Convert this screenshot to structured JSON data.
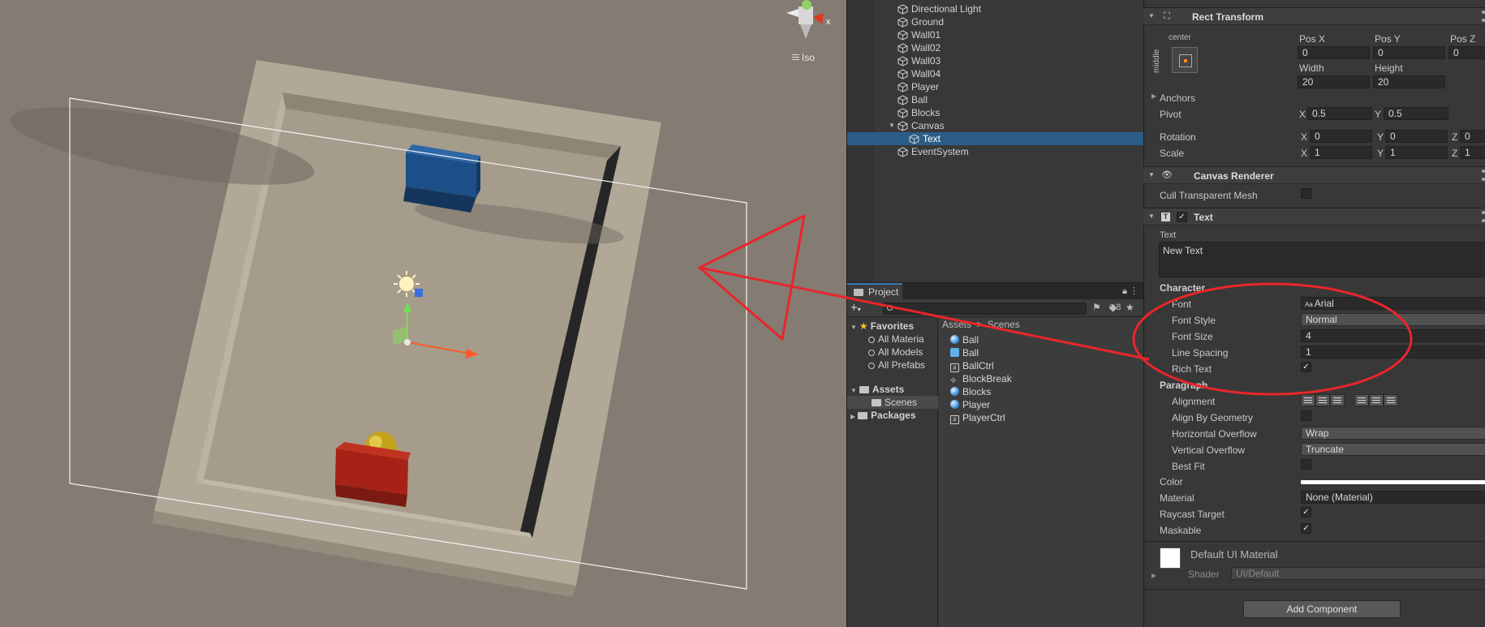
{
  "scene": {
    "view_mode": "Iso",
    "gizmo_axis": "x"
  },
  "hierarchy": {
    "items": [
      {
        "label": "Directional Light",
        "depth": 0
      },
      {
        "label": "Ground",
        "depth": 0
      },
      {
        "label": "Wall01",
        "depth": 0
      },
      {
        "label": "Wall02",
        "depth": 0
      },
      {
        "label": "Wall03",
        "depth": 0
      },
      {
        "label": "Wall04",
        "depth": 0
      },
      {
        "label": "Player",
        "depth": 0
      },
      {
        "label": "Ball",
        "depth": 0
      },
      {
        "label": "Blocks",
        "depth": 0
      },
      {
        "label": "Canvas",
        "depth": 0,
        "expanded": true
      },
      {
        "label": "Text",
        "depth": 1,
        "selected": true
      },
      {
        "label": "EventSystem",
        "depth": 0
      }
    ]
  },
  "project": {
    "tab_label": "Project",
    "hidden_count": "8",
    "search_value": "",
    "favorites": {
      "label": "Favorites",
      "items": [
        "All Materia",
        "All Models",
        "All Prefabs"
      ]
    },
    "tree": {
      "assets": "Assets",
      "scenes": "Scenes",
      "packages": "Packages"
    },
    "breadcrumb": {
      "root": "Assets",
      "sep": ">",
      "current": "Scenes"
    },
    "assets": [
      {
        "name": "Ball",
        "kind": "material"
      },
      {
        "name": "Ball",
        "kind": "prefab"
      },
      {
        "name": "BallCtrl",
        "kind": "script"
      },
      {
        "name": "BlockBreak",
        "kind": "scene"
      },
      {
        "name": "Blocks",
        "kind": "material"
      },
      {
        "name": "Player",
        "kind": "material"
      },
      {
        "name": "PlayerCtrl",
        "kind": "script"
      }
    ]
  },
  "inspector": {
    "rect_transform": {
      "title": "Rect Transform",
      "anchor_h": "center",
      "anchor_v": "middle",
      "pos_x_label": "Pos X",
      "pos_x": "0",
      "pos_y_label": "Pos Y",
      "pos_y": "0",
      "pos_z_label": "Pos Z",
      "pos_z": "0",
      "width_label": "Width",
      "width": "20",
      "height_label": "Height",
      "height": "20",
      "anchors_label": "Anchors",
      "pivot_label": "Pivot",
      "pivot_x": "0.5",
      "pivot_y": "0.5",
      "rotation_label": "Rotation",
      "rot_x": "0",
      "rot_y": "0",
      "rot_z": "0",
      "scale_label": "Scale",
      "scale_x": "1",
      "scale_y": "1",
      "scale_z": "1",
      "axis_x": "X",
      "axis_y": "Y",
      "axis_z": "Z"
    },
    "canvas_renderer": {
      "title": "Canvas Renderer",
      "cull_label": "Cull Transparent Mesh",
      "cull_value": false
    },
    "text": {
      "title": "Text",
      "text_label": "Text",
      "text_value": "New Text",
      "character_label": "Character",
      "font_label": "Font",
      "font_value": "Arial",
      "font_style_label": "Font Style",
      "font_style_value": "Normal",
      "font_size_label": "Font Size",
      "font_size_value": "4",
      "line_spacing_label": "Line Spacing",
      "line_spacing_value": "1",
      "rich_text_label": "Rich Text",
      "rich_text_value": true,
      "paragraph_label": "Paragraph",
      "alignment_label": "Alignment",
      "align_geom_label": "Align By Geometry",
      "align_geom_value": false,
      "h_overflow_label": "Horizontal Overflow",
      "h_overflow_value": "Wrap",
      "v_overflow_label": "Vertical Overflow",
      "v_overflow_value": "Truncate",
      "best_fit_label": "Best Fit",
      "best_fit_value": false,
      "color_label": "Color",
      "color_value": "#ffffff",
      "material_label": "Material",
      "material_value": "None (Material)",
      "raycast_label": "Raycast Target",
      "raycast_value": true,
      "maskable_label": "Maskable",
      "maskable_value": true
    },
    "material_preview": {
      "name": "Default UI Material",
      "shader_label": "Shader",
      "shader_value": "UI/Default"
    },
    "add_component": "Add Component"
  },
  "colors": {
    "selection": "#2c5d87",
    "annotation": "#e8262b",
    "scene_bg": "#847b72"
  }
}
